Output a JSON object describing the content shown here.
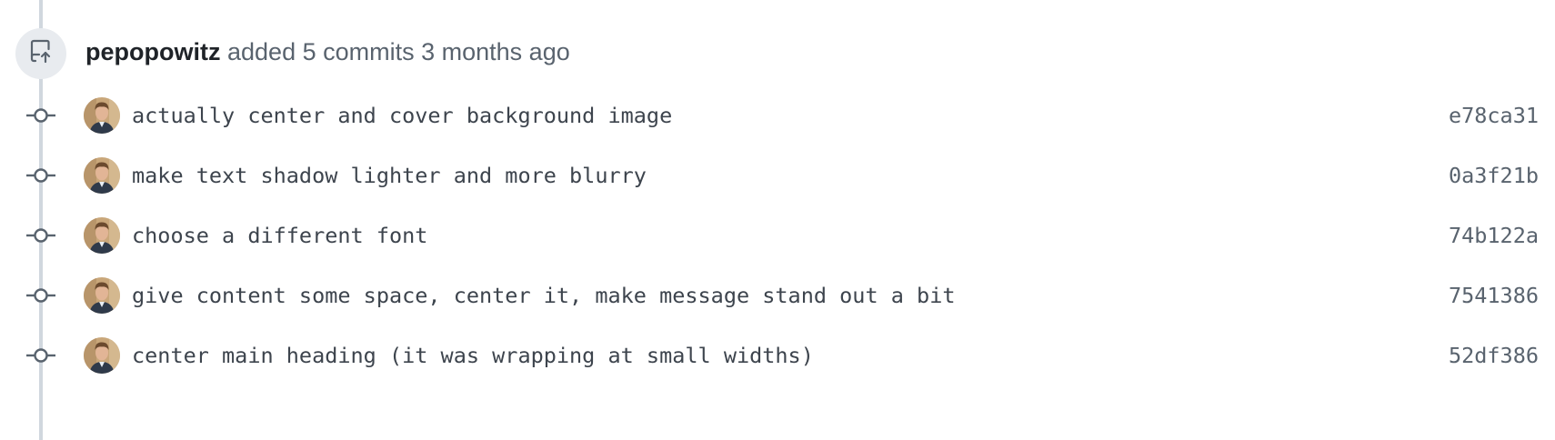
{
  "event": {
    "icon": "repo-push-icon",
    "author": "pepopowitz",
    "action_text": "added 5 commits",
    "time_ago": "3 months ago"
  },
  "commits": [
    {
      "message": "actually center and cover background image",
      "sha": "e78ca31",
      "avatar": "author-avatar"
    },
    {
      "message": "make text shadow lighter and more blurry",
      "sha": "0a3f21b",
      "avatar": "author-avatar"
    },
    {
      "message": "choose a different font",
      "sha": "74b122a",
      "avatar": "author-avatar"
    },
    {
      "message": "give content some space, center it, make message stand out a bit",
      "sha": "7541386",
      "avatar": "author-avatar"
    },
    {
      "message": "center main heading (it was wrapping at small widths)",
      "sha": "52df386",
      "avatar": "author-avatar"
    }
  ],
  "colors": {
    "timeline": "#d0d7de",
    "badge_bg": "#e8ebef",
    "icon": "#59636e",
    "text_primary": "#1f2328",
    "text_muted": "#59636e"
  }
}
